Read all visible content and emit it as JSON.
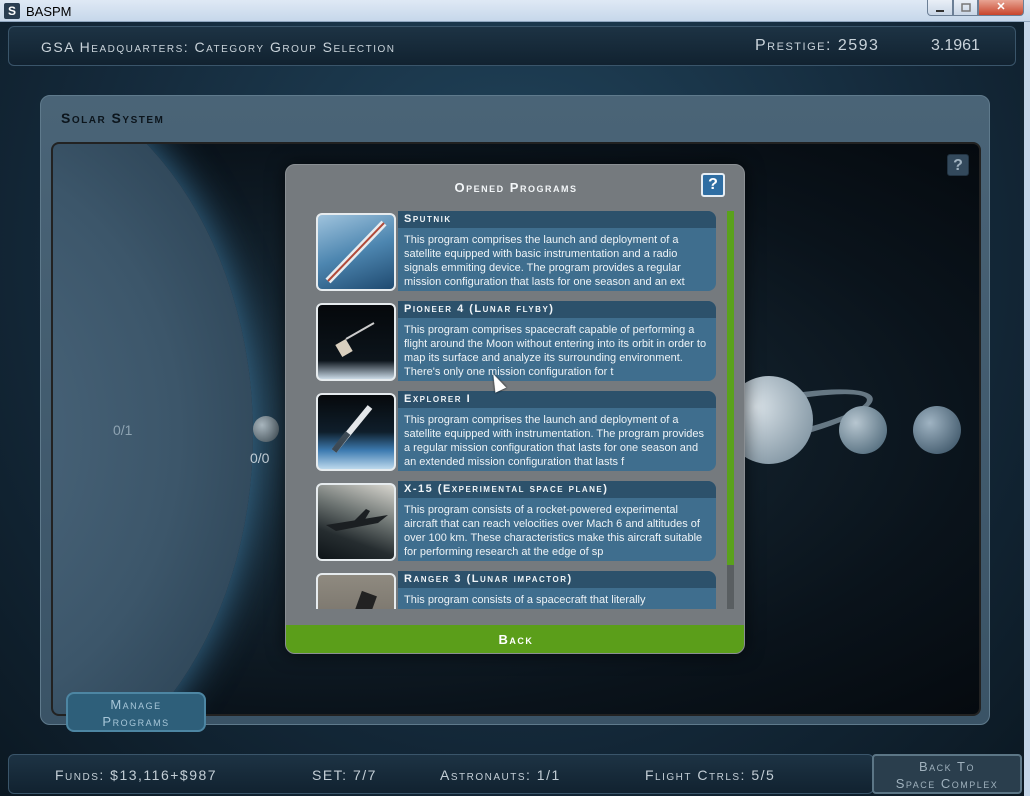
{
  "window": {
    "app_icon": "S",
    "title": "BASPM",
    "minimize_icon": "minimize-icon",
    "maximize_icon": "maximize-icon",
    "close_icon": "close-icon",
    "close_label": "✕"
  },
  "header": {
    "title": "GSA Headquarters:  Category Group Selection",
    "prestige": "Prestige: 2593",
    "version": "3.1961"
  },
  "solar": {
    "title": "Solar System",
    "help_label": "?",
    "counts": {
      "sun": "0/1",
      "mercury": "0/0"
    },
    "manage_line1": "Manage",
    "manage_line2": "Programs"
  },
  "modal": {
    "title": "Opened Programs",
    "help_label": "?",
    "back_label": "Back",
    "scroll_fraction": 0.89,
    "programs": [
      {
        "name": "Sputnik",
        "thumb": "sputnik-satellite-icon",
        "desc": "This program comprises the launch and deployment of a satellite equipped with basic instrumentation and a radio signals emmiting device. The program provides a regular mission configuration that lasts for one season and an ext"
      },
      {
        "name": "Pioneer 4 (Lunar flyby)",
        "thumb": "probe-icon",
        "desc": "This program comprises spacecraft capable of performing a flight around the Moon without entering into its orbit in order to map its surface and analyze its surrounding environment. There's only one mission configuration for t"
      },
      {
        "name": "Explorer I",
        "thumb": "rocket-orbit-icon",
        "desc": "This program comprises the launch and deployment of a satellite equipped with instrumentation. The program provides a regular mission configuration that lasts for one season and an extended mission configuration that lasts f"
      },
      {
        "name": "X-15 (Experimental space plane)",
        "thumb": "space-plane-icon",
        "desc": "This program consists of a rocket-powered experimental aircraft that can reach velocities over Mach 6 and altitudes of over 100 km. These characteristics make this aircraft suitable for performing research at the edge of sp"
      },
      {
        "name": "Ranger 3 (Lunar impactor)",
        "thumb": "lunar-impactor-icon",
        "desc": "This program consists of a spacecraft that literally"
      }
    ]
  },
  "footer": {
    "funds": "Funds: $13,116+$987",
    "set": "SET: 7/7",
    "astronauts": "Astronauts: 1/1",
    "flight_ctrls": "Flight Ctrls: 5/5",
    "back_line1": "Back To",
    "back_line2": "Space Complex"
  }
}
